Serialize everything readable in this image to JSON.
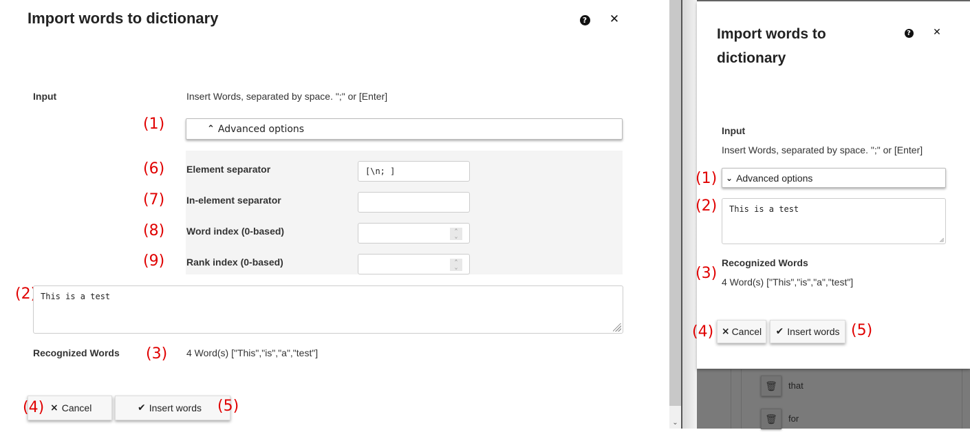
{
  "left_dialog": {
    "title": "Import words to dictionary",
    "help_icon": "question-circle-icon",
    "close_icon": "close-icon",
    "input_label": "Input",
    "input_hint": "Insert Words, separated by space. \";\" or [Enter]",
    "advanced_toggle": {
      "label": "Advanced options",
      "icon": "chevron-up-icon",
      "expanded": true
    },
    "advanced": {
      "element_separator": {
        "label": "Element separator",
        "value": "[\\n; ]"
      },
      "in_element_separator": {
        "label": "In-element separator",
        "value": ""
      },
      "word_index": {
        "label": "Word index (0-based)",
        "value": ""
      },
      "rank_index": {
        "label": "Rank index (0-based)",
        "value": ""
      }
    },
    "words_text": "This is a test",
    "recognized_label": "Recognized Words",
    "recognized_value": "4 Word(s) [\"This\",\"is\",\"a\",\"test\"]",
    "cancel": {
      "label": "Cancel",
      "icon": "×"
    },
    "insert": {
      "label": "Insert words",
      "icon": "✔"
    }
  },
  "right_dialog": {
    "title": "Import words to dictionary",
    "input_label": "Input",
    "input_hint": "Insert Words, separated by space. \";\" or [Enter]",
    "advanced_toggle": {
      "label": "Advanced options",
      "icon": "chevron-down-icon",
      "expanded": false
    },
    "words_text": "This is a test",
    "recognized_label": "Recognized Words",
    "recognized_value": "4 Word(s) [\"This\",\"is\",\"a\",\"test\"]",
    "cancel": {
      "label": "Cancel",
      "icon": "×"
    },
    "insert": {
      "label": "Insert words",
      "icon": "✔"
    }
  },
  "background_list": [
    "that",
    "for"
  ],
  "annotations": {
    "a1": "(1)",
    "a2": "(2)",
    "a3": "(3)",
    "a4": "(4)",
    "a5": "(5)",
    "a6": "(6)",
    "a7": "(7)",
    "a8": "(8)",
    "a9": "(9)"
  },
  "colors": {
    "annotation": "#e00000",
    "advanced_bg": "#f4f4f4",
    "overlay": "#7a7a7a"
  }
}
